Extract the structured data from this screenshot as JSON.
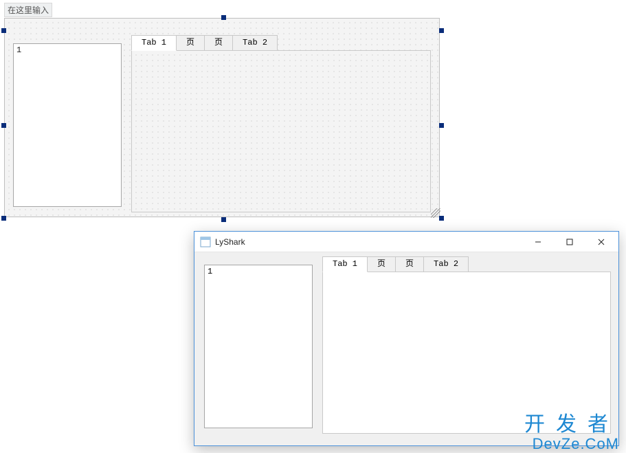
{
  "designer": {
    "title_placeholder": "在这里输入",
    "listbox": {
      "items": [
        "1"
      ]
    },
    "tabs": [
      {
        "label": "Tab 1",
        "active": true
      },
      {
        "label": "页",
        "active": false
      },
      {
        "label": "页",
        "active": false
      },
      {
        "label": "Tab 2",
        "active": false
      }
    ]
  },
  "runtime": {
    "window_title": "LyShark",
    "listbox": {
      "items": [
        "1"
      ]
    },
    "tabs": [
      {
        "label": "Tab 1",
        "active": true
      },
      {
        "label": "页",
        "active": false
      },
      {
        "label": "页",
        "active": false
      },
      {
        "label": "Tab 2",
        "active": false
      }
    ]
  },
  "watermark": {
    "line1": "开发者",
    "line2": "DevZe.CoM"
  }
}
